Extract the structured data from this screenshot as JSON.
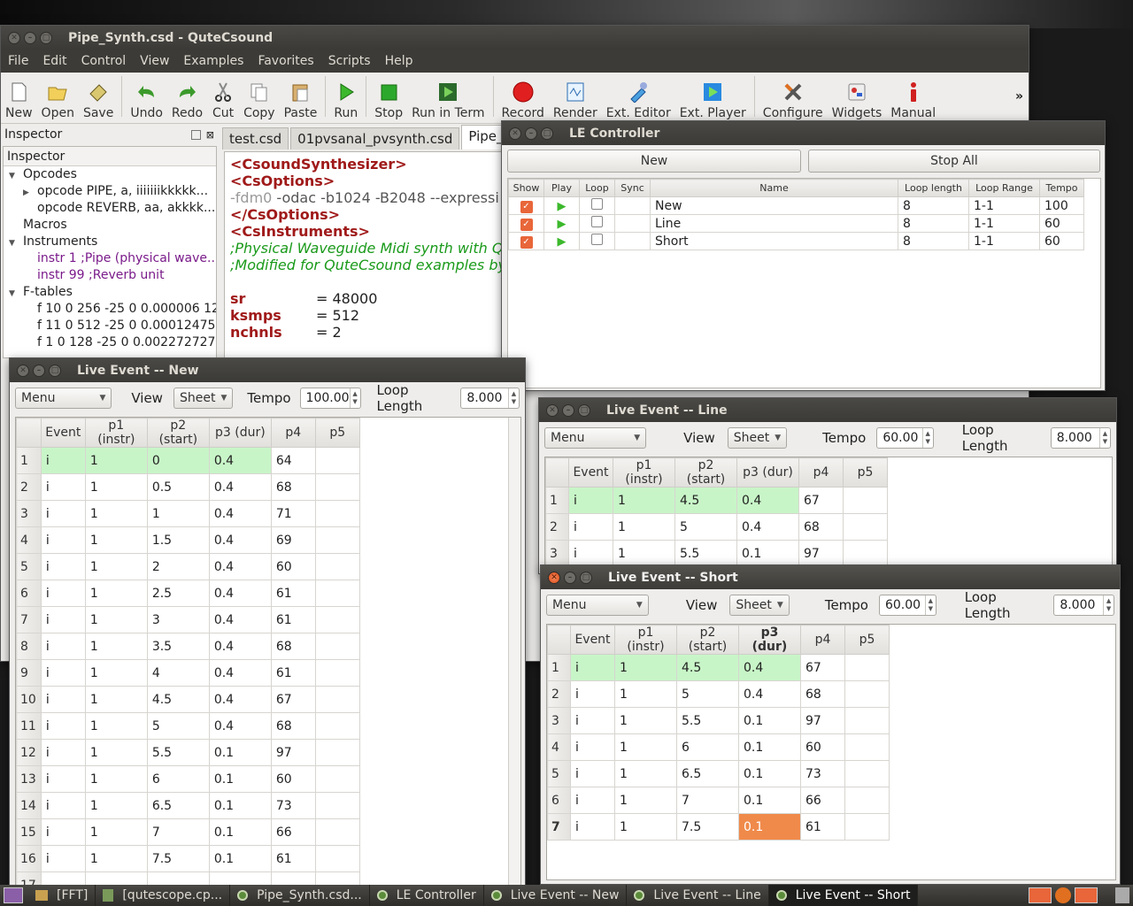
{
  "main_window": {
    "title": "Pipe_Synth.csd - QuteCsound",
    "menu": [
      "File",
      "Edit",
      "Control",
      "View",
      "Examples",
      "Favorites",
      "Scripts",
      "Help"
    ],
    "toolbar": [
      {
        "label": "New",
        "icon": "new-file-icon"
      },
      {
        "label": "Open",
        "icon": "open-folder-icon"
      },
      {
        "label": "Save",
        "icon": "save-icon"
      },
      {
        "label": "Undo",
        "icon": "undo-icon"
      },
      {
        "label": "Redo",
        "icon": "redo-icon"
      },
      {
        "label": "Cut",
        "icon": "cut-icon"
      },
      {
        "label": "Copy",
        "icon": "copy-icon"
      },
      {
        "label": "Paste",
        "icon": "paste-icon"
      },
      {
        "label": "Run",
        "icon": "run-icon"
      },
      {
        "label": "Stop",
        "icon": "stop-icon"
      },
      {
        "label": "Run in Term",
        "icon": "run-in-term-icon"
      },
      {
        "label": "Record",
        "icon": "record-icon"
      },
      {
        "label": "Render",
        "icon": "render-icon"
      },
      {
        "label": "Ext. Editor",
        "icon": "ext-editor-icon"
      },
      {
        "label": "Ext. Player",
        "icon": "ext-player-icon"
      },
      {
        "label": "Configure",
        "icon": "configure-icon"
      },
      {
        "label": "Widgets",
        "icon": "widgets-icon"
      },
      {
        "label": "Manual",
        "icon": "manual-icon"
      }
    ],
    "toolbar_overflow": "»",
    "inspector": {
      "dock_title": "Inspector",
      "header": "Inspector",
      "tree": [
        {
          "label": "Opcodes",
          "level": 0,
          "arrow": "▼"
        },
        {
          "label": "opcode PIPE, a, iiiiiiikkkkk...",
          "level": 1,
          "arrow": "▶"
        },
        {
          "label": "opcode REVERB, aa, akkkk...",
          "level": 1,
          "arrow": ""
        },
        {
          "label": "Macros",
          "level": 0,
          "arrow": ""
        },
        {
          "label": "Instruments",
          "level": 0,
          "arrow": "▼"
        },
        {
          "label": "instr 1 ;Pipe (physical wave...",
          "level": 1,
          "arrow": "",
          "purple": true
        },
        {
          "label": "instr 99 ;Reverb unit",
          "level": 1,
          "arrow": "",
          "purple": true
        },
        {
          "label": "F-tables",
          "level": 0,
          "arrow": "▼"
        },
        {
          "label": "f 10 0 256 -25 0 0.000006 12...",
          "level": 1,
          "arrow": ""
        },
        {
          "label": "f 11 0 512 -25 0 0.00012475 ...",
          "level": 1,
          "arrow": ""
        },
        {
          "label": "f 1 0 128 -25 0 0.002272727...",
          "level": 1,
          "arrow": ""
        }
      ]
    },
    "tabs": [
      "test.csd",
      "01pvsanal_pvsynth.csd",
      "Pipe_Synth"
    ],
    "editor": {
      "l1": "<CsoundSynthesizer>",
      "l2": "<CsOptions>",
      "l3a": "-fdm0",
      "l3b": " -odac -b1024 -B2048 --expressi",
      "l4": "</CsOptions>",
      "l5": "<CsInstruments>",
      "l6": ";Physical Waveguide Midi synth with Qu",
      "l7": ";Modified for QuteCsound examples by",
      "sr_k": "sr",
      "sr_v": "= 48000",
      "ks_k": "ksmps",
      "ks_v": "= 512",
      "nc_k": "nchnls",
      "nc_v": "= 2"
    }
  },
  "le_controller": {
    "title": "LE Controller",
    "new_button": "New",
    "stop_all_button": "Stop All",
    "columns": [
      "Show",
      "Play",
      "Loop",
      "Sync",
      "Name",
      "Loop length",
      "Loop Range",
      "Tempo"
    ],
    "rows": [
      {
        "name": "New",
        "loop_length": "8",
        "loop_range": "1-1",
        "tempo": "100"
      },
      {
        "name": "Line",
        "loop_length": "8",
        "loop_range": "1-1",
        "tempo": "60"
      },
      {
        "name": "Short",
        "loop_length": "8",
        "loop_range": "1-1",
        "tempo": "60"
      }
    ]
  },
  "sheet_columns": [
    "Event",
    "p1 (instr)",
    "p2 (start)",
    "p3 (dur)",
    "p4",
    "p5"
  ],
  "live_new": {
    "title": "Live Event -- New",
    "menu": "Menu",
    "view_label": "View",
    "view_value": "Sheet",
    "tempo_label": "Tempo",
    "tempo_value": "100.00",
    "loop_label": "Loop Length",
    "loop_value": "8.000",
    "rows": [
      [
        "i",
        "1",
        "0",
        "0.4",
        "64"
      ],
      [
        "i",
        "1",
        "0.5",
        "0.4",
        "68"
      ],
      [
        "i",
        "1",
        "1",
        "0.4",
        "71"
      ],
      [
        "i",
        "1",
        "1.5",
        "0.4",
        "69"
      ],
      [
        "i",
        "1",
        "2",
        "0.4",
        "60"
      ],
      [
        "i",
        "1",
        "2.5",
        "0.4",
        "61"
      ],
      [
        "i",
        "1",
        "3",
        "0.4",
        "61"
      ],
      [
        "i",
        "1",
        "3.5",
        "0.4",
        "68"
      ],
      [
        "i",
        "1",
        "4",
        "0.4",
        "61"
      ],
      [
        "i",
        "1",
        "4.5",
        "0.4",
        "67"
      ],
      [
        "i",
        "1",
        "5",
        "0.4",
        "68"
      ],
      [
        "i",
        "1",
        "5.5",
        "0.1",
        "97"
      ],
      [
        "i",
        "1",
        "6",
        "0.1",
        "60"
      ],
      [
        "i",
        "1",
        "6.5",
        "0.1",
        "73"
      ],
      [
        "i",
        "1",
        "7",
        "0.1",
        "66"
      ],
      [
        "i",
        "1",
        "7.5",
        "0.1",
        "61"
      ],
      [
        "",
        "",
        "",
        "",
        ""
      ]
    ]
  },
  "live_line": {
    "title": "Live Event -- Line",
    "menu": "Menu",
    "view_label": "View",
    "view_value": "Sheet",
    "tempo_label": "Tempo",
    "tempo_value": "60.00",
    "loop_label": "Loop Length",
    "loop_value": "8.000",
    "rows": [
      [
        "i",
        "1",
        "4.5",
        "0.4",
        "67"
      ],
      [
        "i",
        "1",
        "5",
        "0.4",
        "68"
      ],
      [
        "i",
        "1",
        "5.5",
        "0.1",
        "97"
      ]
    ]
  },
  "live_short": {
    "title": "Live Event -- Short",
    "menu": "Menu",
    "view_label": "View",
    "view_value": "Sheet",
    "tempo_label": "Tempo",
    "tempo_value": "60.00",
    "loop_label": "Loop Length",
    "loop_value": "8.000",
    "rows": [
      [
        "i",
        "1",
        "4.5",
        "0.4",
        "67"
      ],
      [
        "i",
        "1",
        "5",
        "0.4",
        "68"
      ],
      [
        "i",
        "1",
        "5.5",
        "0.1",
        "97"
      ],
      [
        "i",
        "1",
        "6",
        "0.1",
        "60"
      ],
      [
        "i",
        "1",
        "6.5",
        "0.1",
        "73"
      ],
      [
        "i",
        "1",
        "7",
        "0.1",
        "66"
      ],
      [
        "i",
        "1",
        "7.5",
        "0.1",
        "61"
      ]
    ]
  },
  "taskbar": [
    {
      "label": "[FFT]",
      "icon": "folder-icon"
    },
    {
      "label": "[qutescope.cp...",
      "icon": "editor-icon"
    },
    {
      "label": "Pipe_Synth.csd...",
      "icon": "qutecsound-icon"
    },
    {
      "label": "LE Controller",
      "icon": "qutecsound-icon"
    },
    {
      "label": "Live Event -- New",
      "icon": "qutecsound-icon"
    },
    {
      "label": "Live Event -- Line",
      "icon": "qutecsound-icon"
    },
    {
      "label": "Live Event -- Short",
      "icon": "qutecsound-icon",
      "active": true
    }
  ],
  "colors": {
    "accent_orange": "#f08a4b",
    "row_green": "#c8f5c8",
    "csound_tag": "#a01a1a",
    "comment": "#1a9a1a"
  }
}
